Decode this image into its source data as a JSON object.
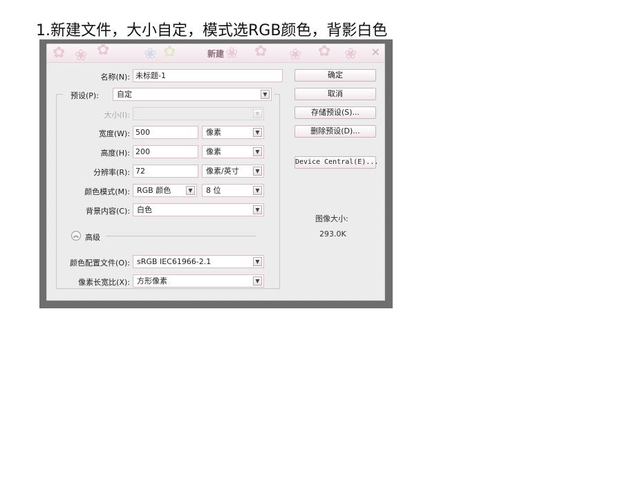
{
  "instruction": "1.新建文件，大小自定，模式选RGB颜色，背影白色",
  "dialog": {
    "title": "新建",
    "close_glyph": "✕",
    "name_label": "名称(N):",
    "name_value": "未标题-1",
    "preset_label": "预设(P):",
    "preset_value": "自定",
    "size_label": "大小(I):",
    "size_value": "",
    "width_label": "宽度(W):",
    "width_value": "500",
    "width_unit": "像素",
    "height_label": "高度(H):",
    "height_value": "200",
    "height_unit": "像素",
    "resolution_label": "分辨率(R):",
    "resolution_value": "72",
    "resolution_unit": "像素/英寸",
    "color_mode_label": "颜色模式(M):",
    "color_mode_value": "RGB 颜色",
    "bit_depth_value": "8 位",
    "background_label": "背景内容(C):",
    "background_value": "白色",
    "advanced_label": "高级",
    "profile_label": "颜色配置文件(O):",
    "profile_value": "sRGB IEC61966-2.1",
    "pixel_aspect_label": "像素长宽比(X):",
    "pixel_aspect_value": "方形像素",
    "buttons": {
      "ok": "确定",
      "cancel": "取消",
      "save_preset": "存储预设(S)...",
      "delete_preset": "删除预设(D)...",
      "device_central": "Device Central(E)..."
    },
    "image_size_label": "图像大小:",
    "image_size_value": "293.0K"
  },
  "colors": {
    "frame": "#6e6e6e",
    "dialog_bg": "#ececec",
    "field_border": "#e2b8c5",
    "title_text": "#8a6f78"
  }
}
